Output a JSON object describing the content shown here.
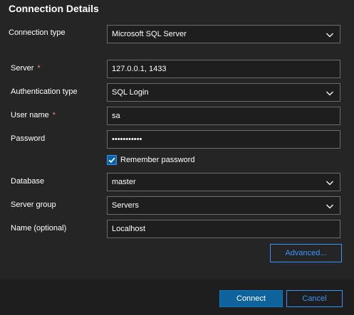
{
  "dialog": {
    "title": "Connection Details"
  },
  "form": {
    "connection_type": {
      "label": "Connection type",
      "value": "Microsoft SQL Server"
    },
    "server": {
      "label": "Server",
      "required_mark": "*",
      "value": "127.0.0.1, 1433"
    },
    "authentication_type": {
      "label": "Authentication type",
      "value": "SQL Login"
    },
    "user_name": {
      "label": "User name",
      "required_mark": "*",
      "value": "sa"
    },
    "password": {
      "label": "Password",
      "value": "sapassword1"
    },
    "remember_password": {
      "label": "Remember password",
      "checked": true
    },
    "database": {
      "label": "Database",
      "value": "master"
    },
    "server_group": {
      "label": "Server group",
      "value": "Servers"
    },
    "name": {
      "label": "Name (optional)",
      "value": "Localhost"
    }
  },
  "buttons": {
    "advanced": "Advanced...",
    "connect": "Connect",
    "cancel": "Cancel"
  },
  "icons": {
    "dropdown": "chevron-down-icon",
    "checkbox": "checkmark-icon"
  },
  "colors": {
    "accent": "#3794ff",
    "primary_button": "#0e639c",
    "required": "#f48771",
    "background": "#252526",
    "input_background": "#1e1e1e",
    "input_border": "#6b6b6b"
  }
}
